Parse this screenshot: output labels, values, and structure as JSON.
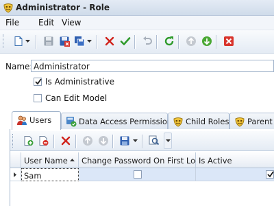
{
  "window": {
    "title": "Administrator - Role",
    "icon": "role-mask-icon"
  },
  "menu": [
    "File",
    "Edit",
    "View"
  ],
  "toolbar": {
    "buttons": [
      "new-document-icon",
      "save-icon",
      "save-and-close-icon",
      "save-options-icon",
      "delete-icon",
      "accept-icon",
      "undo-icon",
      "refresh-icon",
      "previous-record-icon",
      "next-record-icon",
      "close-icon"
    ]
  },
  "form": {
    "name_label": "Name:",
    "name_value": "Administrator",
    "is_administrative_label": "Is Administrative",
    "is_administrative_checked": true,
    "can_edit_model_label": "Can Edit Model",
    "can_edit_model_checked": false
  },
  "tabs": [
    {
      "label": "Users",
      "icon": "users-icon",
      "active": true
    },
    {
      "label": "Data Access Permissions",
      "icon": "data-access-icon",
      "active": false
    },
    {
      "label": "Child Roles",
      "icon": "role-mask-icon",
      "active": false
    },
    {
      "label": "Parent Roles",
      "icon": "role-mask-icon",
      "active": false
    }
  ],
  "grid": {
    "columns": [
      "User Name",
      "Change Password On First Logon",
      "Is Active"
    ],
    "sort": {
      "column": "User Name",
      "direction": "ascending"
    },
    "rows": [
      {
        "user_name": "Sam",
        "change_password_on_first_logon": false,
        "is_active": true
      }
    ]
  }
}
